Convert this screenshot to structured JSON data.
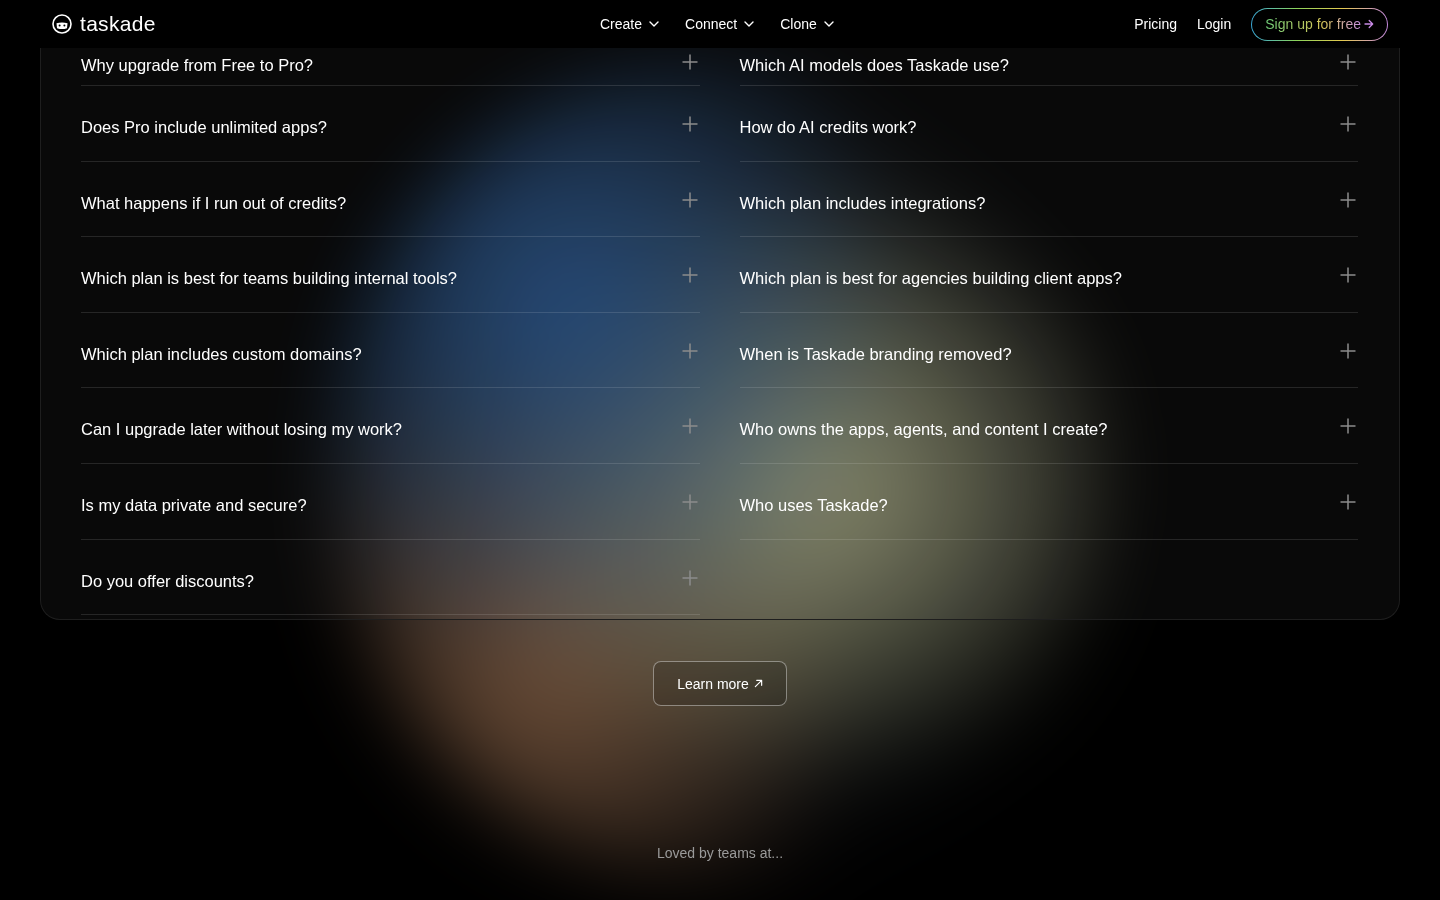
{
  "header": {
    "logo": "taskade",
    "menus": [
      "Create",
      "Connect",
      "Clone"
    ],
    "links": [
      "Pricing",
      "Login"
    ],
    "signup_button": "Sign up for free"
  },
  "faq": {
    "columns": [
      {
        "items": [
          {
            "question": "Why upgrade from Free to Pro?",
            "expanded": false
          },
          {
            "question": "Does Pro include unlimited apps?",
            "expanded": false
          },
          {
            "question": "What happens if I run out of credits?",
            "expanded": false
          },
          {
            "question": "Which plan is best for teams building internal tools?",
            "expanded": false
          },
          {
            "question": "Which plan includes custom domains?",
            "expanded": false
          },
          {
            "question": "Can I upgrade later without losing my work?",
            "expanded": false
          },
          {
            "question": "Is my data private and secure?",
            "expanded": false
          },
          {
            "question": "Do you offer discounts?",
            "expanded": false
          }
        ]
      },
      {
        "items": [
          {
            "question": "Which AI models does Taskade use?",
            "expanded": false
          },
          {
            "question": "How do AI credits work?",
            "expanded": false
          },
          {
            "question": "Which plan includes integrations?",
            "expanded": false
          },
          {
            "question": "Which plan is best for agencies building client apps?",
            "expanded": false
          },
          {
            "question": "When is Taskade branding removed?",
            "expanded": false
          },
          {
            "question": "Who owns the apps, agents, and content I create?",
            "expanded": false
          },
          {
            "question": "Who uses Taskade?",
            "expanded": false
          }
        ]
      }
    ]
  },
  "learn_more_button": "Learn more",
  "tagline": "Loved by teams at..."
}
